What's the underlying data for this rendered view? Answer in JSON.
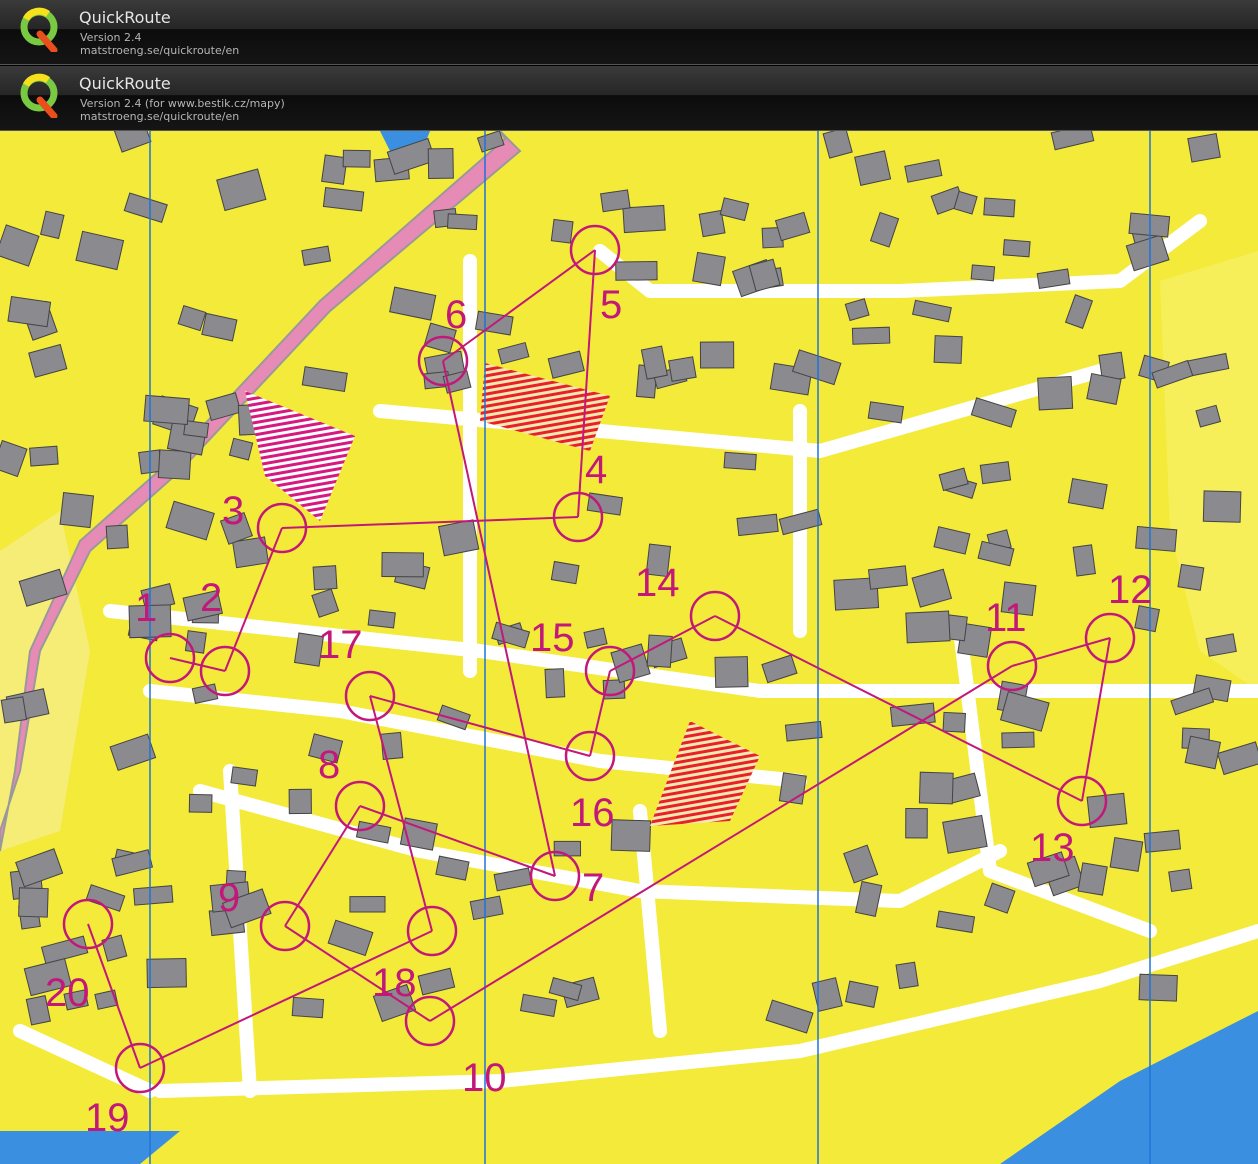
{
  "banners": [
    {
      "title": "QuickRoute",
      "version": "Version 2.4",
      "url": "matstroeng.se/quickroute/en"
    },
    {
      "title": "QuickRoute",
      "version": "Version 2.4  (for www.bestik.cz/mapy)",
      "url": "matstroeng.se/quickroute/en"
    }
  ],
  "map": {
    "kind": "orienteering map",
    "course_color": "#c2187a",
    "ground_color": "#f4ea3a",
    "building_color": "#8a8a8f",
    "water_color": "#3b8fe0",
    "controls": [
      "1",
      "2",
      "3",
      "4",
      "5",
      "6",
      "7",
      "8",
      "9",
      "10",
      "11",
      "12",
      "13",
      "14",
      "15",
      "16",
      "17",
      "18",
      "19",
      "20"
    ]
  }
}
